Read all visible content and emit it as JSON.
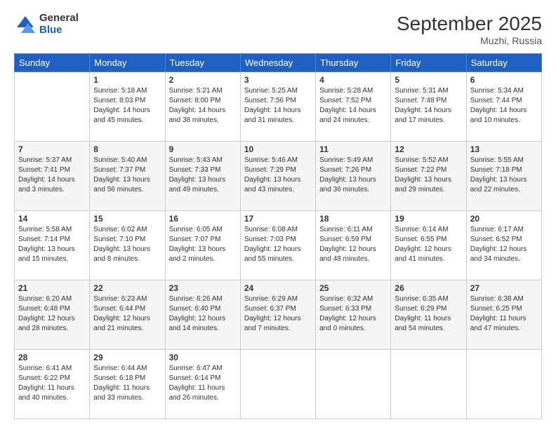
{
  "header": {
    "logo": {
      "general": "General",
      "blue": "Blue"
    },
    "title": "September 2025",
    "subtitle": "Muzhi, Russia"
  },
  "calendar": {
    "days_of_week": [
      "Sunday",
      "Monday",
      "Tuesday",
      "Wednesday",
      "Thursday",
      "Friday",
      "Saturday"
    ],
    "weeks": [
      {
        "shaded": false,
        "days": [
          {
            "date": "",
            "info": ""
          },
          {
            "date": "1",
            "info": "Sunrise: 5:18 AM\nSunset: 8:03 PM\nDaylight: 14 hours\nand 45 minutes."
          },
          {
            "date": "2",
            "info": "Sunrise: 5:21 AM\nSunset: 8:00 PM\nDaylight: 14 hours\nand 38 minutes."
          },
          {
            "date": "3",
            "info": "Sunrise: 5:25 AM\nSunset: 7:56 PM\nDaylight: 14 hours\nand 31 minutes."
          },
          {
            "date": "4",
            "info": "Sunrise: 5:28 AM\nSunset: 7:52 PM\nDaylight: 14 hours\nand 24 minutes."
          },
          {
            "date": "5",
            "info": "Sunrise: 5:31 AM\nSunset: 7:48 PM\nDaylight: 14 hours\nand 17 minutes."
          },
          {
            "date": "6",
            "info": "Sunrise: 5:34 AM\nSunset: 7:44 PM\nDaylight: 14 hours\nand 10 minutes."
          }
        ]
      },
      {
        "shaded": true,
        "days": [
          {
            "date": "7",
            "info": "Sunrise: 5:37 AM\nSunset: 7:41 PM\nDaylight: 14 hours\nand 3 minutes."
          },
          {
            "date": "8",
            "info": "Sunrise: 5:40 AM\nSunset: 7:37 PM\nDaylight: 13 hours\nand 56 minutes."
          },
          {
            "date": "9",
            "info": "Sunrise: 5:43 AM\nSunset: 7:33 PM\nDaylight: 13 hours\nand 49 minutes."
          },
          {
            "date": "10",
            "info": "Sunrise: 5:46 AM\nSunset: 7:29 PM\nDaylight: 13 hours\nand 43 minutes."
          },
          {
            "date": "11",
            "info": "Sunrise: 5:49 AM\nSunset: 7:26 PM\nDaylight: 13 hours\nand 36 minutes."
          },
          {
            "date": "12",
            "info": "Sunrise: 5:52 AM\nSunset: 7:22 PM\nDaylight: 13 hours\nand 29 minutes."
          },
          {
            "date": "13",
            "info": "Sunrise: 5:55 AM\nSunset: 7:18 PM\nDaylight: 13 hours\nand 22 minutes."
          }
        ]
      },
      {
        "shaded": false,
        "days": [
          {
            "date": "14",
            "info": "Sunrise: 5:58 AM\nSunset: 7:14 PM\nDaylight: 13 hours\nand 15 minutes."
          },
          {
            "date": "15",
            "info": "Sunrise: 6:02 AM\nSunset: 7:10 PM\nDaylight: 13 hours\nand 8 minutes."
          },
          {
            "date": "16",
            "info": "Sunrise: 6:05 AM\nSunset: 7:07 PM\nDaylight: 13 hours\nand 2 minutes."
          },
          {
            "date": "17",
            "info": "Sunrise: 6:08 AM\nSunset: 7:03 PM\nDaylight: 12 hours\nand 55 minutes."
          },
          {
            "date": "18",
            "info": "Sunrise: 6:11 AM\nSunset: 6:59 PM\nDaylight: 12 hours\nand 48 minutes."
          },
          {
            "date": "19",
            "info": "Sunrise: 6:14 AM\nSunset: 6:55 PM\nDaylight: 12 hours\nand 41 minutes."
          },
          {
            "date": "20",
            "info": "Sunrise: 6:17 AM\nSunset: 6:52 PM\nDaylight: 12 hours\nand 34 minutes."
          }
        ]
      },
      {
        "shaded": true,
        "days": [
          {
            "date": "21",
            "info": "Sunrise: 6:20 AM\nSunset: 6:48 PM\nDaylight: 12 hours\nand 28 minutes."
          },
          {
            "date": "22",
            "info": "Sunrise: 6:23 AM\nSunset: 6:44 PM\nDaylight: 12 hours\nand 21 minutes."
          },
          {
            "date": "23",
            "info": "Sunrise: 6:26 AM\nSunset: 6:40 PM\nDaylight: 12 hours\nand 14 minutes."
          },
          {
            "date": "24",
            "info": "Sunrise: 6:29 AM\nSunset: 6:37 PM\nDaylight: 12 hours\nand 7 minutes."
          },
          {
            "date": "25",
            "info": "Sunrise: 6:32 AM\nSunset: 6:33 PM\nDaylight: 12 hours\nand 0 minutes."
          },
          {
            "date": "26",
            "info": "Sunrise: 6:35 AM\nSunset: 6:29 PM\nDaylight: 11 hours\nand 54 minutes."
          },
          {
            "date": "27",
            "info": "Sunrise: 6:38 AM\nSunset: 6:25 PM\nDaylight: 11 hours\nand 47 minutes."
          }
        ]
      },
      {
        "shaded": false,
        "days": [
          {
            "date": "28",
            "info": "Sunrise: 6:41 AM\nSunset: 6:22 PM\nDaylight: 11 hours\nand 40 minutes."
          },
          {
            "date": "29",
            "info": "Sunrise: 6:44 AM\nSunset: 6:18 PM\nDaylight: 11 hours\nand 33 minutes."
          },
          {
            "date": "30",
            "info": "Sunrise: 6:47 AM\nSunset: 6:14 PM\nDaylight: 11 hours\nand 26 minutes."
          },
          {
            "date": "",
            "info": ""
          },
          {
            "date": "",
            "info": ""
          },
          {
            "date": "",
            "info": ""
          },
          {
            "date": "",
            "info": ""
          }
        ]
      }
    ]
  }
}
